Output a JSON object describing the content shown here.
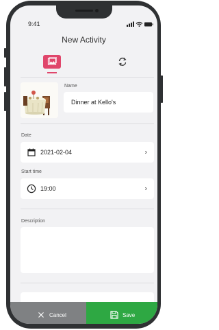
{
  "status": {
    "time": "9:41"
  },
  "header": {
    "title": "New Activity"
  },
  "tabs": [
    {
      "icon": "image-icon",
      "active": true,
      "color": "#e0466b"
    },
    {
      "icon": "sync-icon",
      "active": false
    }
  ],
  "form": {
    "name_label": "Name",
    "name_value": "Dinner at Kello's",
    "date_label": "Date",
    "date_value": "2021-02-04",
    "start_label": "Start time",
    "start_value": "19:00",
    "description_label": "Description",
    "description_value": ""
  },
  "footer": {
    "cancel_label": "Cancel",
    "save_label": "Save",
    "cancel_color": "#7f8183",
    "save_color": "#2ea843"
  }
}
